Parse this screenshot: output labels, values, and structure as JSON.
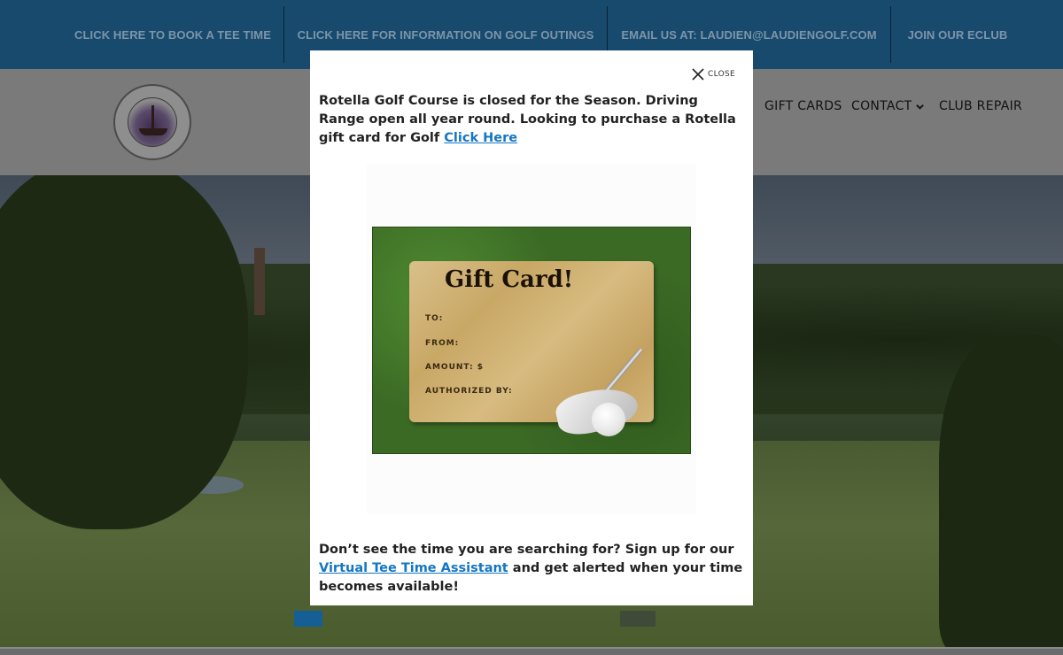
{
  "topbar": {
    "items": [
      {
        "label": "CLICK HERE TO BOOK A TEE TIME"
      },
      {
        "label": "CLICK HERE FOR INFORMATION ON GOLF OUTINGS"
      },
      {
        "label": "EMAIL US AT: LAUDIEN@LAUDIENGOLF.COM"
      },
      {
        "label": "JOIN OUR ECLUB"
      }
    ]
  },
  "nav": {
    "gift_cards": "GIFT CARDS",
    "contact": "CONTACT",
    "club_repair": "CLUB REPAIR"
  },
  "modal": {
    "close_label": "CLOSE",
    "intro_text": "Rotella Golf Course is closed for the Season.  Driving Range open all year round.  Looking to purchase a Rotella gift card for Golf ",
    "intro_link": "Click Here",
    "bottom_text": "Don’t see the time you are searching for? Sign up for our ",
    "bottom_link": "Virtual Tee Time Assistant",
    "bottom_text_after": "  and get alerted when your time becomes available!"
  },
  "gift_card": {
    "title": "Gift Card!",
    "to": "TO:",
    "from": "FROM:",
    "amount": "AMOUNT:  $",
    "authorized": "AUTHORIZED BY:"
  },
  "colors": {
    "topbar_bg": "#184a6e",
    "link": "#1576c2",
    "slider_active": "#155f96"
  },
  "icons": {
    "close": "close-icon",
    "contact_dropdown": "chevron-down-icon",
    "logo": "ship-logo-icon"
  }
}
